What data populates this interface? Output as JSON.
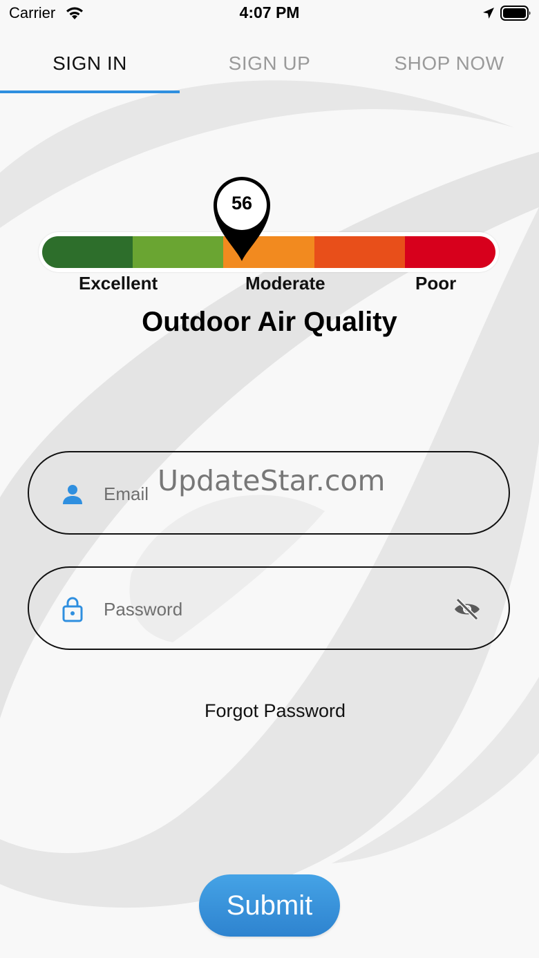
{
  "status_bar": {
    "carrier": "Carrier",
    "time": "4:07 PM",
    "icons": [
      "wifi-icon",
      "location-arrow-icon",
      "battery-icon"
    ]
  },
  "tabs": [
    {
      "label": "SIGN IN",
      "active": true
    },
    {
      "label": "SIGN UP",
      "active": false
    },
    {
      "label": "SHOP NOW",
      "active": false
    }
  ],
  "air_quality": {
    "value": "56",
    "labels": {
      "low": "Excellent",
      "mid": "Moderate",
      "high": "Poor"
    },
    "title": "Outdoor Air Quality",
    "segment_colors": [
      "#2d6e2b",
      "#6aa532",
      "#f28a1f",
      "#e84f1a",
      "#d7001c"
    ]
  },
  "form": {
    "email": {
      "placeholder": "Email",
      "icon": "person-icon"
    },
    "password": {
      "placeholder": "Password",
      "icon": "lock-icon",
      "toggle_icon": "eye-slash-icon"
    },
    "forgot_password": "Forgot Password",
    "submit": "Submit"
  },
  "watermark": "UpdateStar.com",
  "colors": {
    "accent": "#2f8fdf",
    "background": "#f8f8f8"
  }
}
